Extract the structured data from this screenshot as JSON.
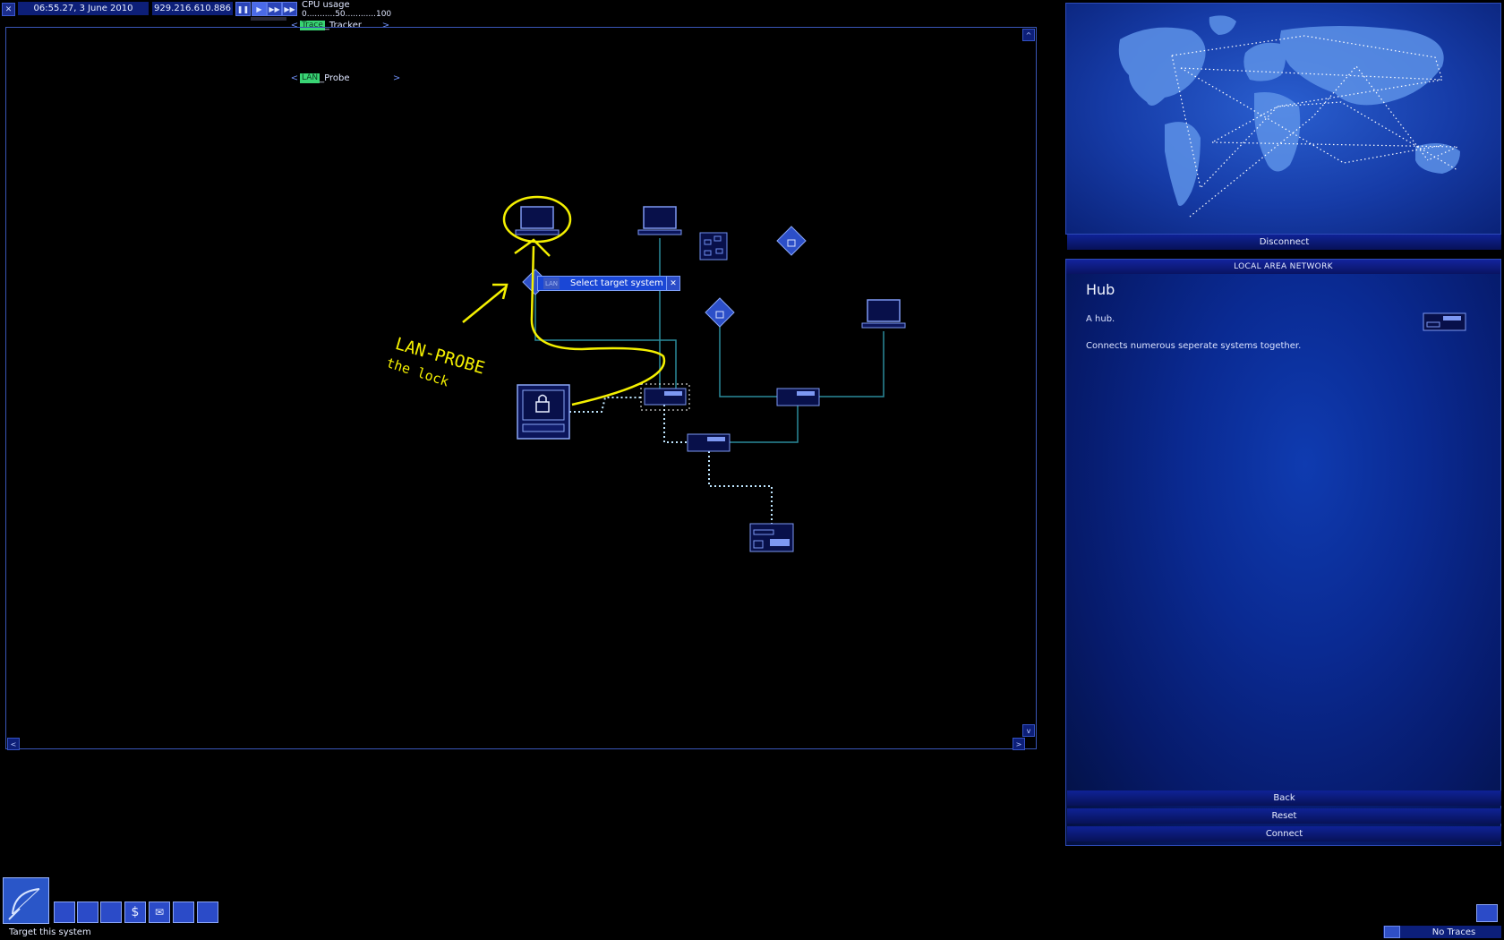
{
  "topbar": {
    "clock": "06:55.27, 3 June 2010",
    "ip": "929.216.610.886",
    "cpu_label": "CPU usage",
    "cpu_scale": "0...........50............100",
    "programs": [
      {
        "name": "Trace_Tracker",
        "bar_text": "Trace",
        "rest": "_Tracker"
      },
      {
        "name": "LAN_Probe",
        "bar_text": "LAN",
        "rest": "_Probe"
      }
    ]
  },
  "lan": {
    "tooltip": "Select target system",
    "tooltip_chip": "LAN",
    "scroll_up": "^",
    "scroll_down": "v",
    "scroll_left": "<",
    "scroll_right": ">"
  },
  "annotation": {
    "line1": "LAN-PROBE",
    "line2": "the lock"
  },
  "world_map": {
    "disconnect_label": "Disconnect"
  },
  "info_panel": {
    "header": "LOCAL AREA NETWORK",
    "title": "Hub",
    "description": "A hub.",
    "detail": "Connects numerous seperate systems together.",
    "buttons": {
      "back": "Back",
      "reset": "Reset",
      "connect": "Connect"
    }
  },
  "status": {
    "bottom_text": "Target this system",
    "traces": "No Traces"
  },
  "colors": {
    "annotation": "#f4f000",
    "link": "#2a8a9a",
    "node": "#6f8ff0"
  }
}
